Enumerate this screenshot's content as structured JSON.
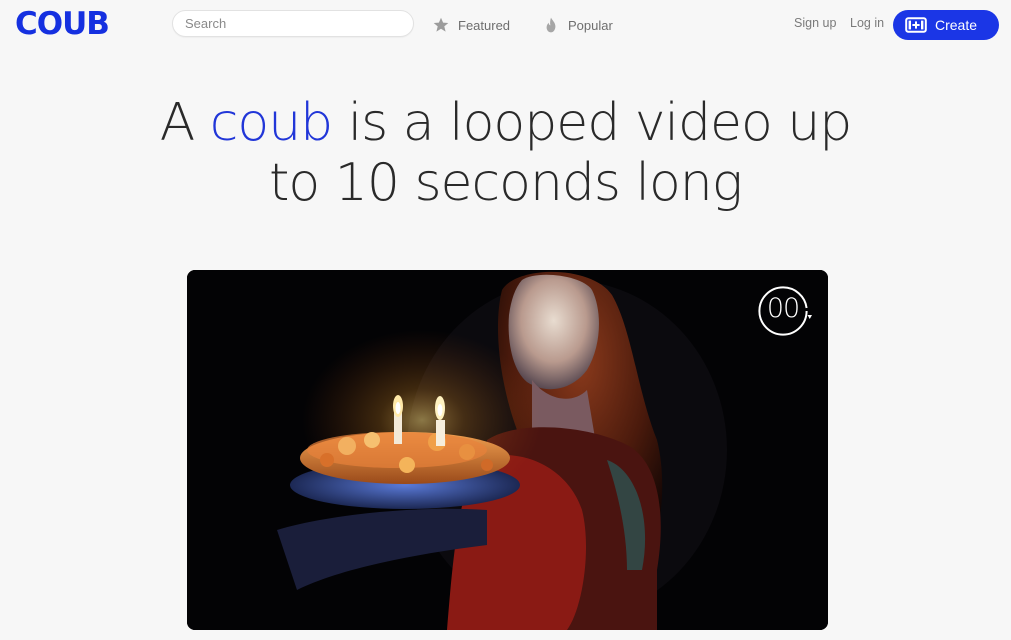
{
  "header": {
    "logo": "COUB",
    "search_placeholder": "Search",
    "nav": [
      {
        "label": "Featured",
        "icon": "star-icon"
      },
      {
        "label": "Popular",
        "icon": "flame-icon"
      }
    ],
    "signup_label": "Sign up",
    "login_label": "Log in",
    "create_label": "Create",
    "create_icon": "add-video-icon"
  },
  "hero": {
    "prefix": "A ",
    "accent_word": "coub",
    "line1_rest": " is a looped video up",
    "line2": "to 10 seconds long"
  },
  "video": {
    "timer_text": "00",
    "description": "birthday-cake-candles-video"
  },
  "colors": {
    "brand": "#1530e0",
    "accent_text": "#2136d8",
    "create_button": "#1b36e6",
    "page_bg": "#f7f7f7"
  }
}
